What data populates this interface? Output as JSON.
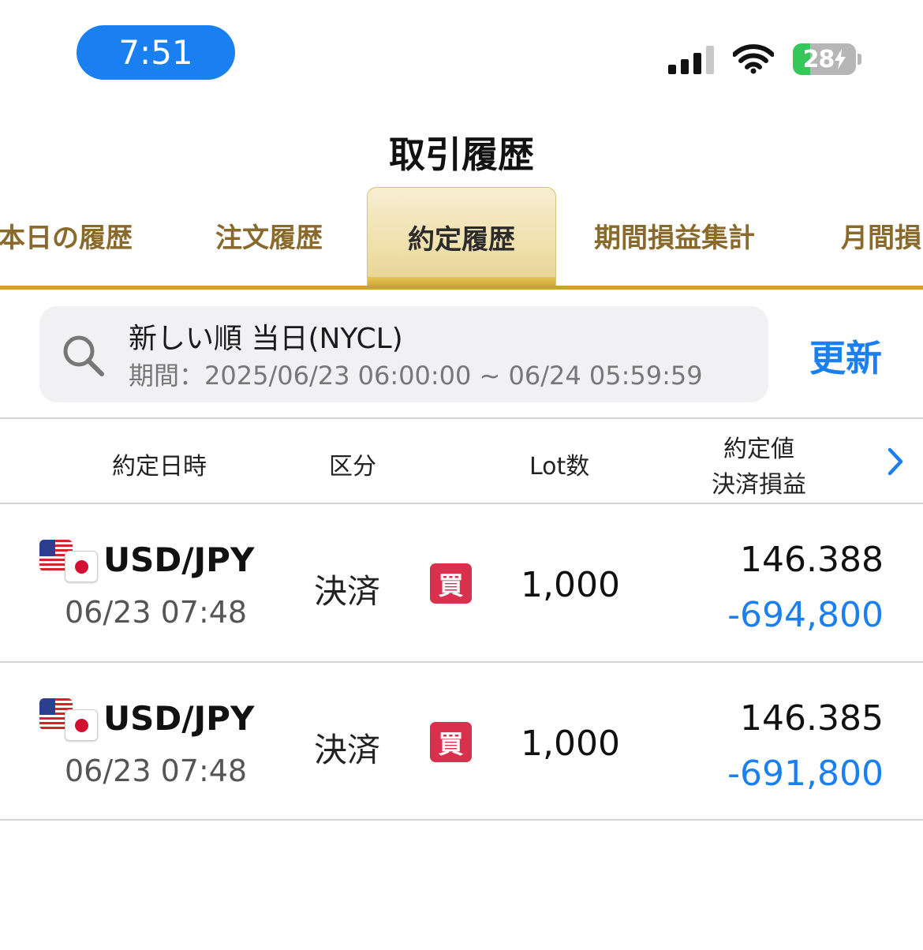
{
  "status_bar": {
    "time": "7:51",
    "battery_level": "28",
    "battery_fraction": 0.28,
    "charging": true
  },
  "header": {
    "title": "取引履歴"
  },
  "tabs": [
    {
      "label": "本日の履歴",
      "active": false
    },
    {
      "label": "注文履歴",
      "active": false
    },
    {
      "label": "約定履歴",
      "active": true
    },
    {
      "label": "期間損益集計",
      "active": false
    },
    {
      "label": "月間損",
      "active": false
    }
  ],
  "filter": {
    "sort_label": "新しい順 当日(NYCL)",
    "period_label": "期間：2025/06/23 06:00:00 ~ 06/24 05:59:59",
    "refresh_label": "更新"
  },
  "table": {
    "headers": {
      "datetime": "約定日時",
      "kind": "区分",
      "lots": "Lot数",
      "price": "約定値",
      "pl": "決済損益"
    },
    "rows": [
      {
        "pair": "USD/JPY",
        "datetime": "06/23 07:48",
        "kind": "決済",
        "side": "買",
        "lots": "1,000",
        "price": "146.388",
        "pl": "-694,800"
      },
      {
        "pair": "USD/JPY",
        "datetime": "06/23 07:48",
        "kind": "決済",
        "side": "買",
        "lots": "1,000",
        "price": "146.385",
        "pl": "-691,800"
      }
    ]
  },
  "colors": {
    "accent_blue": "#1a7ff0",
    "gold": "#c9a23a",
    "buy_badge": "#d9304e",
    "tab_text": "#8a6a2c"
  },
  "icons": [
    "signal-icon",
    "wifi-icon",
    "battery-icon",
    "search-icon",
    "chevron-right-icon",
    "us-flag-icon",
    "jp-flag-icon"
  ]
}
